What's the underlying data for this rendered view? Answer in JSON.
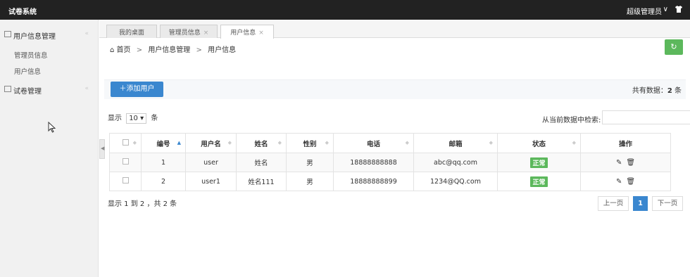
{
  "app": {
    "title": "试卷系统",
    "user": "超级管理员"
  },
  "colors": {
    "topbar": "#222222",
    "primary": "#3a87cf",
    "success": "#5cb85c"
  },
  "sidebar": {
    "groups": [
      {
        "label": "用户信息管理",
        "items": [
          "管理员信息",
          "用户信息"
        ]
      },
      {
        "label": "试卷管理",
        "items": []
      }
    ]
  },
  "tabs": [
    {
      "label": "我的桌面",
      "closable": false
    },
    {
      "label": "管理员信息",
      "closable": true
    },
    {
      "label": "用户信息",
      "closable": true,
      "active": true
    }
  ],
  "breadcrumb": {
    "home": "首页",
    "level1": "用户信息管理",
    "level2": "用户信息",
    "separator": ">"
  },
  "toolbar": {
    "add_label": "添加用户",
    "total_prefix": "共有数据：",
    "total_count": "2",
    "total_suffix": "条"
  },
  "list_controls": {
    "show_prefix": "显示",
    "page_size": "10",
    "show_suffix": "条",
    "search_label": "从当前数据中检索:",
    "search_value": ""
  },
  "table": {
    "headers": [
      "编号",
      "用户名",
      "姓名",
      "性别",
      "电话",
      "邮箱",
      "状态",
      "操作"
    ],
    "rows": [
      {
        "id": "1",
        "username": "user",
        "name": "姓名",
        "gender": "男",
        "phone": "18888888888",
        "email": "abc@qq.com",
        "status": "正常"
      },
      {
        "id": "2",
        "username": "user1",
        "name": "姓名111",
        "gender": "男",
        "phone": "18888888899",
        "email": "1234@QQ.com",
        "status": "正常"
      }
    ]
  },
  "footer": {
    "info": "显示 1 到 2 ，共 2 条"
  },
  "pagination": {
    "prev": "上一页",
    "current": "1",
    "next": "下一页"
  }
}
